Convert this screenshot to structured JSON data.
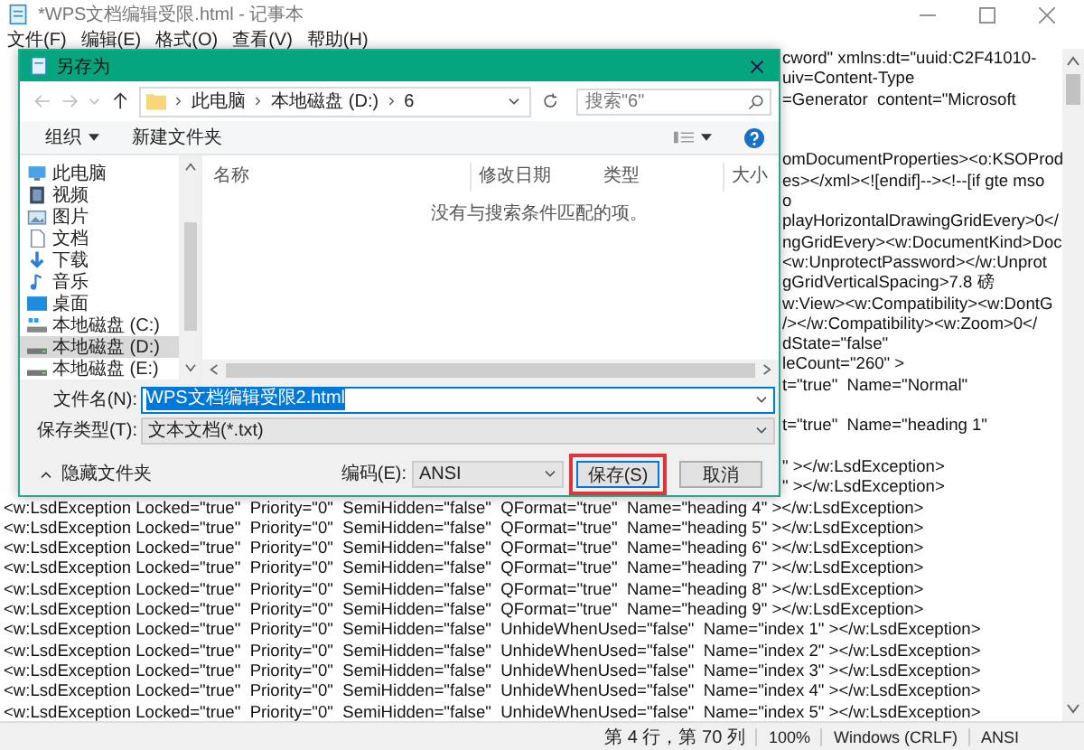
{
  "notepad": {
    "title": "*WPS文档编辑受限.html - 记事本",
    "menu": [
      "文件(F)",
      "编辑(E)",
      "格式(O)",
      "查看(V)",
      "帮助(H)"
    ],
    "lines": [
      {
        "kind": "text",
        "covered": true,
        "text": "cword\" xmlns:dt=\"uuid:C2F41010-"
      },
      {
        "kind": "text",
        "covered": true,
        "text": "uiv=Content-Type"
      },
      {
        "kind": "text",
        "covered": true,
        "text": "=Generator  content=\"Microsoft"
      },
      {
        "kind": "blank"
      },
      {
        "kind": "blank"
      },
      {
        "kind": "text",
        "covered": true,
        "text": "omDocumentProperties><o:KSOProd"
      },
      {
        "kind": "text",
        "covered": true,
        "text": "es></xml><![endif]--><!--[if gte mso"
      },
      {
        "kind": "text",
        "covered": true,
        "text": "o"
      },
      {
        "kind": "text",
        "covered": true,
        "text": "playHorizontalDrawingGridEvery>0</"
      },
      {
        "kind": "text",
        "covered": true,
        "text": "ngGridEvery><w:DocumentKind>Doc"
      },
      {
        "kind": "text",
        "covered": true,
        "text": "<w:UnprotectPassword></w:Unprot"
      },
      {
        "kind": "text",
        "covered": true,
        "text": "gGridVerticalSpacing>7.8 磅"
      },
      {
        "kind": "text",
        "covered": true,
        "text": "w:View><w:Compatibility><w:DontG"
      },
      {
        "kind": "text",
        "covered": true,
        "text": "/></w:Compatibility><w:Zoom>0</"
      },
      {
        "kind": "text",
        "covered": true,
        "text": "dState=\"false\""
      },
      {
        "kind": "text",
        "covered": true,
        "text": "leCount=\"260\" >"
      },
      {
        "kind": "text",
        "covered": true,
        "text": "t=\"true\"  Name=\"Normal\""
      },
      {
        "kind": "blank"
      },
      {
        "kind": "text",
        "covered": true,
        "text": "t=\"true\"  Name=\"heading 1\""
      },
      {
        "kind": "blank"
      },
      {
        "kind": "text",
        "covered": true,
        "text": "\" ></w:LsdException>"
      },
      {
        "kind": "text",
        "covered": true,
        "text": "\" ></w:LsdException>"
      },
      {
        "kind": "text",
        "covered": false,
        "text": "<w:LsdException Locked=\"true\"  Priority=\"0\"  SemiHidden=\"false\"  QFormat=\"true\"  Name=\"heading 4\" ></w:LsdException>"
      },
      {
        "kind": "text",
        "covered": false,
        "text": "<w:LsdException Locked=\"true\"  Priority=\"0\"  SemiHidden=\"false\"  QFormat=\"true\"  Name=\"heading 5\" ></w:LsdException>"
      },
      {
        "kind": "text",
        "covered": false,
        "text": "<w:LsdException Locked=\"true\"  Priority=\"0\"  SemiHidden=\"false\"  QFormat=\"true\"  Name=\"heading 6\" ></w:LsdException>"
      },
      {
        "kind": "text",
        "covered": false,
        "text": "<w:LsdException Locked=\"true\"  Priority=\"0\"  SemiHidden=\"false\"  QFormat=\"true\"  Name=\"heading 7\" ></w:LsdException>"
      },
      {
        "kind": "text",
        "covered": false,
        "text": "<w:LsdException Locked=\"true\"  Priority=\"0\"  SemiHidden=\"false\"  QFormat=\"true\"  Name=\"heading 8\" ></w:LsdException>"
      },
      {
        "kind": "text",
        "covered": false,
        "text": "<w:LsdException Locked=\"true\"  Priority=\"0\"  SemiHidden=\"false\"  QFormat=\"true\"  Name=\"heading 9\" ></w:LsdException>"
      },
      {
        "kind": "text",
        "covered": false,
        "text": "<w:LsdException Locked=\"true\"  Priority=\"0\"  SemiHidden=\"false\"  UnhideWhenUsed=\"false\"  Name=\"index 1\" ></w:LsdException>"
      },
      {
        "kind": "text",
        "covered": false,
        "text": "<w:LsdException Locked=\"true\"  Priority=\"0\"  SemiHidden=\"false\"  UnhideWhenUsed=\"false\"  Name=\"index 2\" ></w:LsdException>"
      },
      {
        "kind": "text",
        "covered": false,
        "text": "<w:LsdException Locked=\"true\"  Priority=\"0\"  SemiHidden=\"false\"  UnhideWhenUsed=\"false\"  Name=\"index 3\" ></w:LsdException>"
      },
      {
        "kind": "text",
        "covered": false,
        "text": "<w:LsdException Locked=\"true\"  Priority=\"0\"  SemiHidden=\"false\"  UnhideWhenUsed=\"false\"  Name=\"index 4\" ></w:LsdException>"
      },
      {
        "kind": "text",
        "covered": false,
        "text": "<w:LsdException Locked=\"true\"  Priority=\"0\"  SemiHidden=\"false\"  UnhideWhenUsed=\"false\"  Name=\"index 5\" ></w:LsdException>"
      }
    ],
    "status_bar": [
      "第 4 行，第 70 列",
      "100%",
      "Windows (CRLF)",
      "ANSI"
    ]
  },
  "save_dialog": {
    "title": "另存为",
    "breadcrumb": [
      "此电脑",
      "本地磁盘 (D:)",
      "6"
    ],
    "search": {
      "placeholder": "搜索\"6\""
    },
    "toolbar": [
      "组织",
      "新建文件夹"
    ],
    "nav_items": [
      {
        "label": "此电脑",
        "kind": "pc",
        "selected": false
      },
      {
        "label": "视频",
        "kind": "video",
        "selected": false
      },
      {
        "label": "图片",
        "kind": "picture",
        "selected": false
      },
      {
        "label": "文档",
        "kind": "document",
        "selected": false
      },
      {
        "label": "下载",
        "kind": "download",
        "selected": false
      },
      {
        "label": "音乐",
        "kind": "music",
        "selected": false
      },
      {
        "label": "桌面",
        "kind": "desktop",
        "selected": false
      },
      {
        "label": "本地磁盘 (C:)",
        "kind": "system",
        "selected": false
      },
      {
        "label": "本地磁盘 (D:)",
        "kind": "drive",
        "selected": true
      },
      {
        "label": "本地磁盘 (E:)",
        "kind": "drive",
        "selected": false
      }
    ],
    "columns": [
      "名称",
      "修改日期",
      "类型",
      "大小"
    ],
    "empty_message": "没有与搜索条件匹配的项。",
    "file_name": {
      "label": "文件名(N):",
      "value": "WPS文档编辑受限2.html"
    },
    "file_type": {
      "label": "保存类型(T):",
      "value": "文本文档(*.txt)"
    },
    "hide_folders": "隐藏文件夹",
    "encoding": {
      "label": "编码(E):",
      "value": "ANSI"
    },
    "buttons": [
      {
        "label": "保存(S)",
        "highlighted": true
      },
      {
        "label": "取消",
        "highlighted": false
      }
    ]
  }
}
